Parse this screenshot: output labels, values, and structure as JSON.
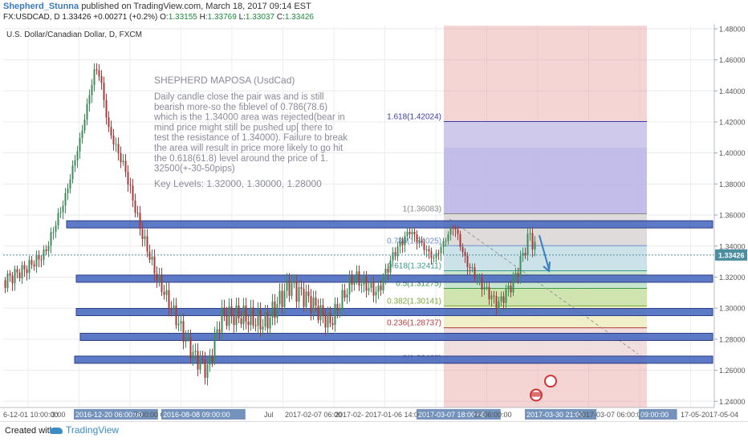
{
  "header": {
    "author": "Shepherd_Stunna",
    "published": "published on TradingView.com, March 18, 2017 09:14 EST",
    "symbol_line": "FX:USDCAD, D",
    "last": "1.33426",
    "change": "+0.00271 (+0.2%)",
    "open_label": "O:",
    "open": "1.33155",
    "high_label": "H:",
    "high": "1.33769",
    "low_label": "L:",
    "low": "1.33037",
    "close_label": "C:",
    "close": "1.33426"
  },
  "chart_data": {
    "type": "candlestick",
    "title": "U.S. Dollar/Canadian Dollar, D, FXCM",
    "ylim": [
      1.236,
      1.482
    ],
    "y_ticks": [
      "1.48000",
      "1.46000",
      "1.44000",
      "1.42000",
      "1.40000",
      "1.38000",
      "1.36000",
      "1.34000",
      "1.32000",
      "1.30000",
      "1.28000",
      "1.26000",
      "1.24000"
    ],
    "y_tick_values": [
      1.48,
      1.46,
      1.44,
      1.42,
      1.4,
      1.38,
      1.36,
      1.34,
      1.32,
      1.3,
      1.28,
      1.26,
      1.24
    ],
    "price_badge": "1.33426",
    "price_badge_value": 1.33426,
    "x_labels": [
      "6-12-01 10:00:00",
      "3:00",
      "2016-12-20 06:00:00",
      "7:00:00 C",
      "2016-08-08 09:00:00",
      "Jul",
      "2017-02-07 06:00",
      "2017-02-",
      "2017-01-06 14:00:00",
      "2017-03-07 18:00:00",
      "22 06:00:00",
      "2017-03-30 21:00",
      "2017-03-07 06:00:00",
      "09:00:00",
      "17-05-",
      "2017-05-04"
    ],
    "annotation": {
      "title": "SHEPHERD MAPOSA (UsdCad)",
      "body": [
        "Daily candle close the pair was and is still",
        "bearish more-so the fiblevel of 0.786(78.6)",
        "which is the 1.34000 area was rejected(bear in",
        "mind price might still be pushed up[ there to",
        "test the resistance of 1.34000). Failure to break",
        "the area will result in price more likely to go hit",
        "the 0.618(61.8) level around the price of 1.",
        "32500(+-30-50pips)"
      ],
      "key_levels": "Key Levels: 1.32000, 1.30000, 1.28000"
    },
    "fib_levels": [
      {
        "label": "1.618(1.42024)",
        "value": 1.42024
      },
      {
        "label": "1(1.36083)",
        "value": 1.36083
      },
      {
        "label": "0.786(1.34025)",
        "value": 1.34025
      },
      {
        "label": "0.618(1.32411)",
        "value": 1.32411
      },
      {
        "label": "0.5(1.31275)",
        "value": 1.31275
      },
      {
        "label": "0.382(1.30141)",
        "value": 1.30141
      },
      {
        "label": "0.236(1.28737)",
        "value": 1.28737
      },
      {
        "label": "0(1.26468)",
        "value": 1.26468
      }
    ],
    "horizontal_zones": [
      {
        "center": 1.354
      },
      {
        "center": 1.319
      },
      {
        "center": 1.2975
      },
      {
        "center": 1.2815
      },
      {
        "center": 1.2668
      }
    ],
    "colors": {
      "up": "#3d8c5a",
      "down": "#a83a3a",
      "zone_fill": "#4f6fc1",
      "zone_stroke": "#1f2f7a",
      "fib_red": "#e8a0a0",
      "fib_blue": "#b8b8ec",
      "fib_green": "#c8e6a8",
      "badge": "#4a8ea0",
      "arrow": "#3b7bbf"
    }
  },
  "footer": {
    "created_with": "Created with",
    "brand": "TradingView"
  }
}
